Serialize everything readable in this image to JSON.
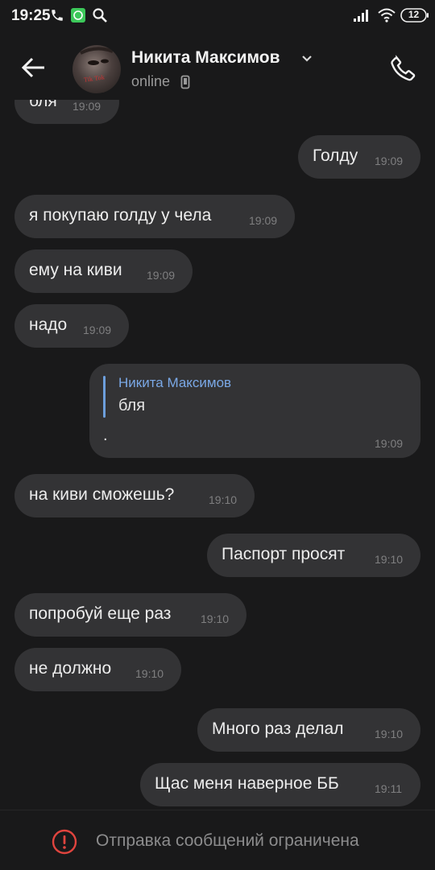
{
  "status_bar": {
    "time": "19:25",
    "battery": "12",
    "icons": [
      "phone-icon",
      "whatsapp-icon",
      "search-icon",
      "signal-icon",
      "wifi-icon",
      "battery-icon"
    ]
  },
  "header": {
    "name": "Никита Максимов",
    "status": "online",
    "avatar_caption": "Tik Tok",
    "icons": [
      "back-arrow-icon",
      "chevron-down-icon",
      "mobile-phone-icon",
      "call-icon"
    ]
  },
  "messages": [
    {
      "text": "бля",
      "time": "19:09",
      "side": "in"
    },
    {
      "text": "Голду",
      "time": "19:09",
      "side": "out"
    },
    {
      "text": "я покупаю голду у чела",
      "time": "19:09",
      "side": "in"
    },
    {
      "text": "ему на киви",
      "time": "19:09",
      "side": "in"
    },
    {
      "text": "надо",
      "time": "19:09",
      "side": "in"
    },
    {
      "text": "на киви сможешь?",
      "time": "19:10",
      "side": "in"
    },
    {
      "text": "Паспорт просят",
      "time": "19:10",
      "side": "out"
    },
    {
      "text": "попробуй еще раз",
      "time": "19:10",
      "side": "in"
    },
    {
      "text": "не должно",
      "time": "19:10",
      "side": "in"
    },
    {
      "text": "Много раз делал",
      "time": "19:10",
      "side": "out"
    },
    {
      "text": "Щас меня наверное ББ",
      "time": "19:11",
      "side": "out"
    }
  ],
  "reply_message": {
    "quoted_name": "Никита Максимов",
    "quoted_text": "бля",
    "text": ".",
    "time": "19:09",
    "side": "out"
  },
  "footer": {
    "text": "Отправка сообщений ограничена",
    "icon": "warning-icon"
  },
  "colors": {
    "background": "#19191a",
    "bubble": "#333335",
    "accent": "#7aa8e6",
    "warning": "#e0443e"
  }
}
